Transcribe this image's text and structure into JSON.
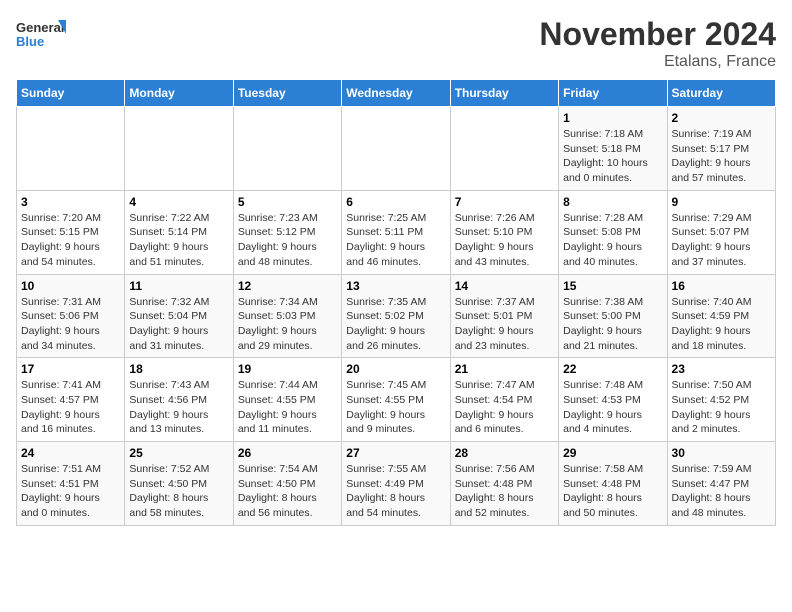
{
  "logo": {
    "line1": "General",
    "line2": "Blue"
  },
  "title": "November 2024",
  "subtitle": "Etalans, France",
  "weekdays": [
    "Sunday",
    "Monday",
    "Tuesday",
    "Wednesday",
    "Thursday",
    "Friday",
    "Saturday"
  ],
  "weeks": [
    [
      {
        "day": "",
        "detail": ""
      },
      {
        "day": "",
        "detail": ""
      },
      {
        "day": "",
        "detail": ""
      },
      {
        "day": "",
        "detail": ""
      },
      {
        "day": "",
        "detail": ""
      },
      {
        "day": "1",
        "detail": "Sunrise: 7:18 AM\nSunset: 5:18 PM\nDaylight: 10 hours\nand 0 minutes."
      },
      {
        "day": "2",
        "detail": "Sunrise: 7:19 AM\nSunset: 5:17 PM\nDaylight: 9 hours\nand 57 minutes."
      }
    ],
    [
      {
        "day": "3",
        "detail": "Sunrise: 7:20 AM\nSunset: 5:15 PM\nDaylight: 9 hours\nand 54 minutes."
      },
      {
        "day": "4",
        "detail": "Sunrise: 7:22 AM\nSunset: 5:14 PM\nDaylight: 9 hours\nand 51 minutes."
      },
      {
        "day": "5",
        "detail": "Sunrise: 7:23 AM\nSunset: 5:12 PM\nDaylight: 9 hours\nand 48 minutes."
      },
      {
        "day": "6",
        "detail": "Sunrise: 7:25 AM\nSunset: 5:11 PM\nDaylight: 9 hours\nand 46 minutes."
      },
      {
        "day": "7",
        "detail": "Sunrise: 7:26 AM\nSunset: 5:10 PM\nDaylight: 9 hours\nand 43 minutes."
      },
      {
        "day": "8",
        "detail": "Sunrise: 7:28 AM\nSunset: 5:08 PM\nDaylight: 9 hours\nand 40 minutes."
      },
      {
        "day": "9",
        "detail": "Sunrise: 7:29 AM\nSunset: 5:07 PM\nDaylight: 9 hours\nand 37 minutes."
      }
    ],
    [
      {
        "day": "10",
        "detail": "Sunrise: 7:31 AM\nSunset: 5:06 PM\nDaylight: 9 hours\nand 34 minutes."
      },
      {
        "day": "11",
        "detail": "Sunrise: 7:32 AM\nSunset: 5:04 PM\nDaylight: 9 hours\nand 31 minutes."
      },
      {
        "day": "12",
        "detail": "Sunrise: 7:34 AM\nSunset: 5:03 PM\nDaylight: 9 hours\nand 29 minutes."
      },
      {
        "day": "13",
        "detail": "Sunrise: 7:35 AM\nSunset: 5:02 PM\nDaylight: 9 hours\nand 26 minutes."
      },
      {
        "day": "14",
        "detail": "Sunrise: 7:37 AM\nSunset: 5:01 PM\nDaylight: 9 hours\nand 23 minutes."
      },
      {
        "day": "15",
        "detail": "Sunrise: 7:38 AM\nSunset: 5:00 PM\nDaylight: 9 hours\nand 21 minutes."
      },
      {
        "day": "16",
        "detail": "Sunrise: 7:40 AM\nSunset: 4:59 PM\nDaylight: 9 hours\nand 18 minutes."
      }
    ],
    [
      {
        "day": "17",
        "detail": "Sunrise: 7:41 AM\nSunset: 4:57 PM\nDaylight: 9 hours\nand 16 minutes."
      },
      {
        "day": "18",
        "detail": "Sunrise: 7:43 AM\nSunset: 4:56 PM\nDaylight: 9 hours\nand 13 minutes."
      },
      {
        "day": "19",
        "detail": "Sunrise: 7:44 AM\nSunset: 4:55 PM\nDaylight: 9 hours\nand 11 minutes."
      },
      {
        "day": "20",
        "detail": "Sunrise: 7:45 AM\nSunset: 4:55 PM\nDaylight: 9 hours\nand 9 minutes."
      },
      {
        "day": "21",
        "detail": "Sunrise: 7:47 AM\nSunset: 4:54 PM\nDaylight: 9 hours\nand 6 minutes."
      },
      {
        "day": "22",
        "detail": "Sunrise: 7:48 AM\nSunset: 4:53 PM\nDaylight: 9 hours\nand 4 minutes."
      },
      {
        "day": "23",
        "detail": "Sunrise: 7:50 AM\nSunset: 4:52 PM\nDaylight: 9 hours\nand 2 minutes."
      }
    ],
    [
      {
        "day": "24",
        "detail": "Sunrise: 7:51 AM\nSunset: 4:51 PM\nDaylight: 9 hours\nand 0 minutes."
      },
      {
        "day": "25",
        "detail": "Sunrise: 7:52 AM\nSunset: 4:50 PM\nDaylight: 8 hours\nand 58 minutes."
      },
      {
        "day": "26",
        "detail": "Sunrise: 7:54 AM\nSunset: 4:50 PM\nDaylight: 8 hours\nand 56 minutes."
      },
      {
        "day": "27",
        "detail": "Sunrise: 7:55 AM\nSunset: 4:49 PM\nDaylight: 8 hours\nand 54 minutes."
      },
      {
        "day": "28",
        "detail": "Sunrise: 7:56 AM\nSunset: 4:48 PM\nDaylight: 8 hours\nand 52 minutes."
      },
      {
        "day": "29",
        "detail": "Sunrise: 7:58 AM\nSunset: 4:48 PM\nDaylight: 8 hours\nand 50 minutes."
      },
      {
        "day": "30",
        "detail": "Sunrise: 7:59 AM\nSunset: 4:47 PM\nDaylight: 8 hours\nand 48 minutes."
      }
    ]
  ]
}
